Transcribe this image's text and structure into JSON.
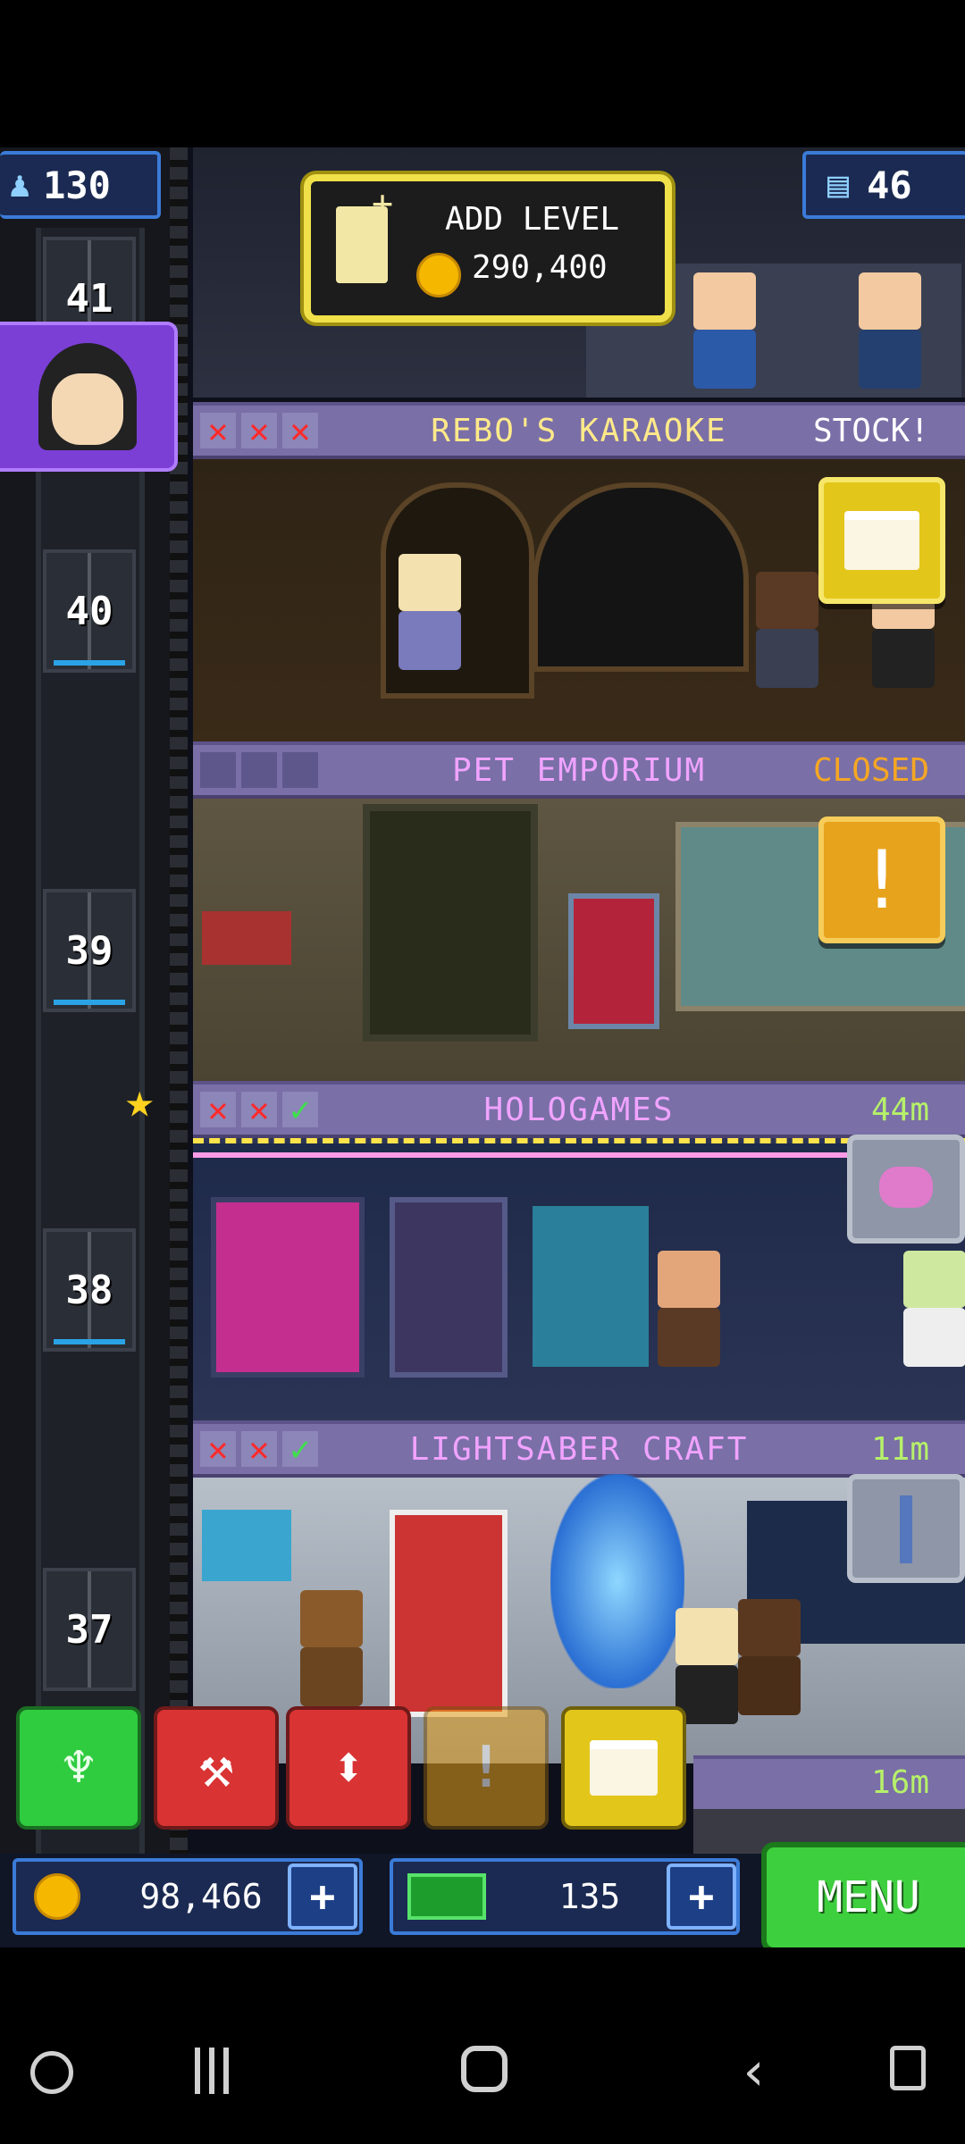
{
  "status_bar": {},
  "header": {
    "population": "130",
    "floors_count": "46",
    "add_level": {
      "title": "ADD LEVEL",
      "cost": "290,400"
    }
  },
  "elevator": {
    "floor_labels": [
      "41",
      "40",
      "39",
      "38",
      "37"
    ]
  },
  "floors": [
    {
      "name": "REBO'S KARAOKE",
      "status": "STOCK!",
      "marks": [
        "x",
        "x",
        "x"
      ],
      "name_color": "#ffe98a",
      "status_color": "#ffffff"
    },
    {
      "name": "PET EMPORIUM",
      "status": "CLOSED",
      "marks": [
        "empty",
        "empty",
        "empty"
      ],
      "name_color": "#f0a3ff",
      "status_color": "#f5a623"
    },
    {
      "name": "HOLOGAMES",
      "status": "44m",
      "marks": [
        "x",
        "x",
        "ok"
      ],
      "name_color": "#f0a3ff",
      "status_color": "#b6f06a"
    },
    {
      "name": "LIGHTSABER CRAFT",
      "status": "11m",
      "marks": [
        "x",
        "x",
        "ok"
      ],
      "name_color": "#f0a3ff",
      "status_color": "#b6f06a"
    },
    {
      "name": "",
      "status": "16m",
      "marks": [],
      "name_color": "#f0a3ff",
      "status_color": "#b6f06a"
    }
  ],
  "mark_glyphs": {
    "x": "✕",
    "ok": "✓",
    "empty": ""
  },
  "currency": {
    "coins": "98,466",
    "bux": "135"
  },
  "menu": {
    "label": "MENU"
  },
  "colors": {
    "green": "#2fcc3f",
    "red": "#d93333",
    "yellow": "#e3c61a",
    "orange": "#e8a31c",
    "menu_green": "#3ecf3e"
  }
}
